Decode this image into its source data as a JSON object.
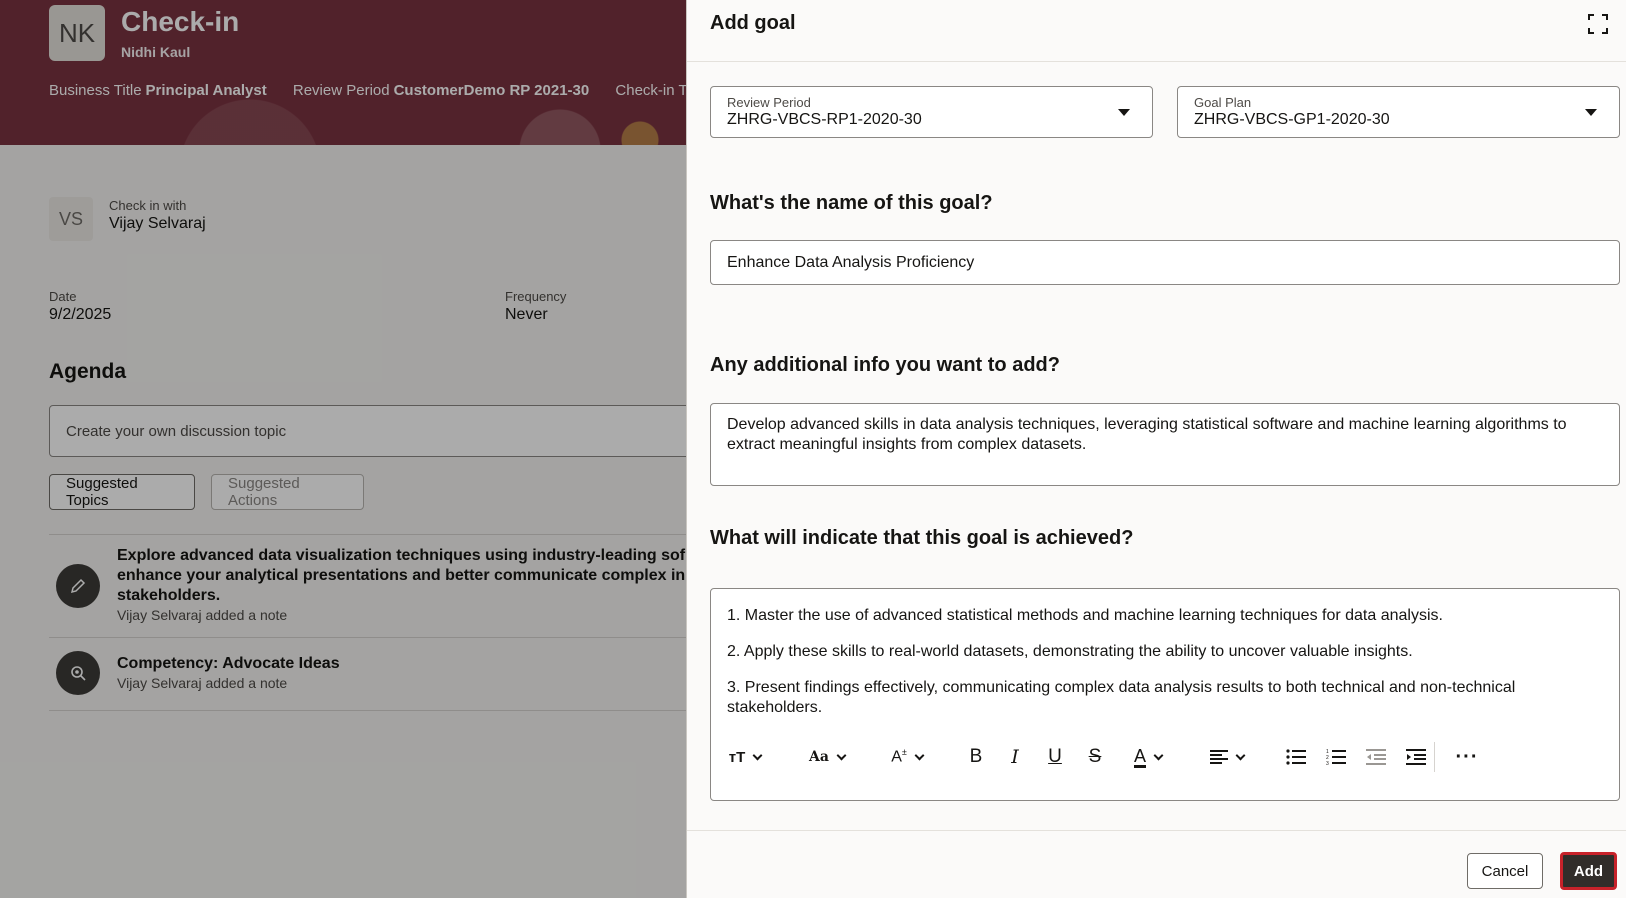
{
  "header": {
    "initials": "NK",
    "title": "Check-in",
    "person": "Nidhi Kaul",
    "business_title_label": "Business Title",
    "business_title": "Principal Analyst",
    "review_period_label": "Review Period",
    "review_period": "CustomerDemo RP 2021-30",
    "template_label": "Check-in Template"
  },
  "checkin": {
    "with_initials": "VS",
    "with_label": "Check in with",
    "with_name": "Vijay Selvaraj",
    "date_label": "Date",
    "date": "9/2/2025",
    "frequency_label": "Frequency",
    "frequency": "Never"
  },
  "agenda": {
    "title": "Agenda",
    "input_placeholder": "Create your own discussion topic",
    "suggested_topics": "Suggested Topics",
    "suggested_actions": "Suggested Actions",
    "items": [
      {
        "lines": [
          "Explore advanced data visualization techniques using industry-leading sof",
          "enhance your analytical presentations and better communicate complex in",
          "stakeholders."
        ],
        "sub": "Vijay Selvaraj added a note",
        "icon": "pencil-icon"
      },
      {
        "lines": [
          "Competency: Advocate Ideas"
        ],
        "sub": "Vijay Selvaraj added a note",
        "icon": "competency-icon"
      }
    ]
  },
  "drawer": {
    "title": "Add goal",
    "review_period_label": "Review Period",
    "review_period_value": "ZHRG-VBCS-RP1-2020-30",
    "goal_plan_label": "Goal Plan",
    "goal_plan_value": "ZHRG-VBCS-GP1-2020-30",
    "name_question": "What's the name of this goal?",
    "name_value": "Enhance Data Analysis Proficiency",
    "info_question": "Any additional info you want to add?",
    "info_lines": [
      "Develop advanced skills in data analysis techniques, leveraging statistical software and machine learning algorithms to",
      "extract meaningful insights from complex datasets."
    ],
    "achieved_question": "What will indicate that this goal is achieved?",
    "achieved_lines": [
      "1. Master the use of advanced statistical methods and machine learning techniques for data analysis.",
      "2. Apply these skills to real-world datasets, demonstrating the ability to uncover valuable insights.",
      "3. Present findings effectively, communicating complex data analysis results to both technical and non-technical",
      "stakeholders."
    ],
    "cancel_label": "Cancel",
    "add_label": "Add",
    "toolbar_icons": [
      "text-size-icon",
      "font-icon",
      "font-size-icon",
      "bold-icon",
      "italic-icon",
      "underline-icon",
      "strikethrough-icon",
      "text-color-icon",
      "align-icon",
      "bullet-list-icon",
      "numbered-list-icon",
      "outdent-icon",
      "indent-icon",
      "more-icon"
    ]
  }
}
